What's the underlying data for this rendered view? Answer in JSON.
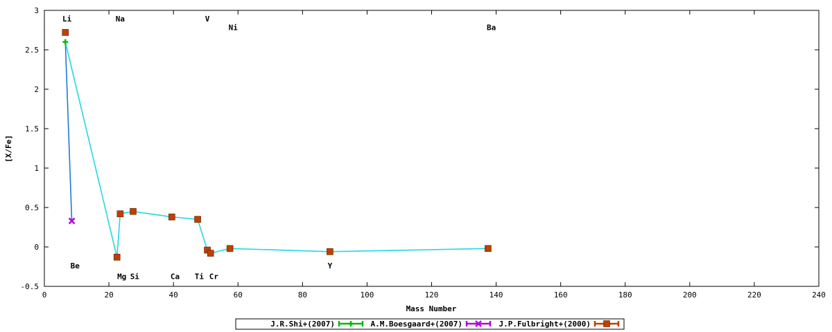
{
  "chart_data": {
    "type": "line",
    "xlabel": "Mass Number",
    "ylabel": "[X/Fe]",
    "xlim": [
      0,
      240
    ],
    "ylim": [
      -0.5,
      3
    ],
    "x_ticks": [
      "0",
      "20",
      "40",
      "60",
      "80",
      "100",
      "120",
      "140",
      "160",
      "180",
      "200",
      "220",
      "240"
    ],
    "y_ticks": [
      "-0.5",
      "0",
      "0.5",
      "1",
      "1.5",
      "2",
      "2.5",
      "3"
    ],
    "legend_position": "bottom",
    "grid": false,
    "series": [
      {
        "name": "J.R.Shi+(2007)",
        "color": "#00bb00",
        "marker": "plus",
        "points": [
          {
            "x": 6.5,
            "y": 2.6
          }
        ]
      },
      {
        "name": "A.M.Boesgaard+(2007)",
        "color": "#b400e0",
        "marker": "cross",
        "points": [
          {
            "x": 8.5,
            "y": 0.33
          }
        ]
      },
      {
        "name": "J.P.Fulbright+(2000)",
        "color": "#c04000",
        "marker": "square",
        "points": [
          {
            "x": 6.5,
            "y": 2.72
          },
          {
            "x": 22.5,
            "y": -0.13
          },
          {
            "x": 23.5,
            "y": 0.42
          },
          {
            "x": 27.5,
            "y": 0.45
          },
          {
            "x": 39.5,
            "y": 0.38
          },
          {
            "x": 47.5,
            "y": 0.35
          },
          {
            "x": 50.5,
            "y": -0.04
          },
          {
            "x": 51.5,
            "y": -0.08
          },
          {
            "x": 57.5,
            "y": -0.02
          },
          {
            "x": 88.5,
            "y": -0.06
          },
          {
            "x": 137.5,
            "y": -0.02
          }
        ]
      }
    ],
    "connector_lines": [
      {
        "color": "#1e78dc",
        "points": [
          {
            "x": 6.5,
            "y": 2.6
          },
          {
            "x": 8.5,
            "y": 0.33
          }
        ]
      },
      {
        "color": "#22d8e0",
        "points": [
          {
            "x": 6.5,
            "y": 2.6
          },
          {
            "x": 22.5,
            "y": -0.13
          },
          {
            "x": 23.5,
            "y": 0.42
          },
          {
            "x": 27.5,
            "y": 0.45
          },
          {
            "x": 39.5,
            "y": 0.38
          },
          {
            "x": 47.5,
            "y": 0.35
          },
          {
            "x": 50.5,
            "y": -0.04
          },
          {
            "x": 51.5,
            "y": -0.08
          },
          {
            "x": 57.5,
            "y": -0.02
          },
          {
            "x": 88.5,
            "y": -0.06
          },
          {
            "x": 137.5,
            "y": -0.02
          }
        ]
      }
    ],
    "element_labels": [
      {
        "text": "Li",
        "x": 7,
        "y": 2.86
      },
      {
        "text": "Na",
        "x": 23.5,
        "y": 2.86
      },
      {
        "text": "V",
        "x": 50.5,
        "y": 2.86
      },
      {
        "text": "Ni",
        "x": 58.5,
        "y": 2.75
      },
      {
        "text": "Ba",
        "x": 138.5,
        "y": 2.75
      },
      {
        "text": "Be",
        "x": 9.5,
        "y": -0.27
      },
      {
        "text": "Y",
        "x": 88.5,
        "y": -0.27
      },
      {
        "text": "Mg",
        "x": 24,
        "y": -0.41
      },
      {
        "text": "Si",
        "x": 28,
        "y": -0.41
      },
      {
        "text": "Ca",
        "x": 40.5,
        "y": -0.41
      },
      {
        "text": "Ti",
        "x": 48,
        "y": -0.41
      },
      {
        "text": "Cr",
        "x": 52.5,
        "y": -0.41
      }
    ]
  }
}
